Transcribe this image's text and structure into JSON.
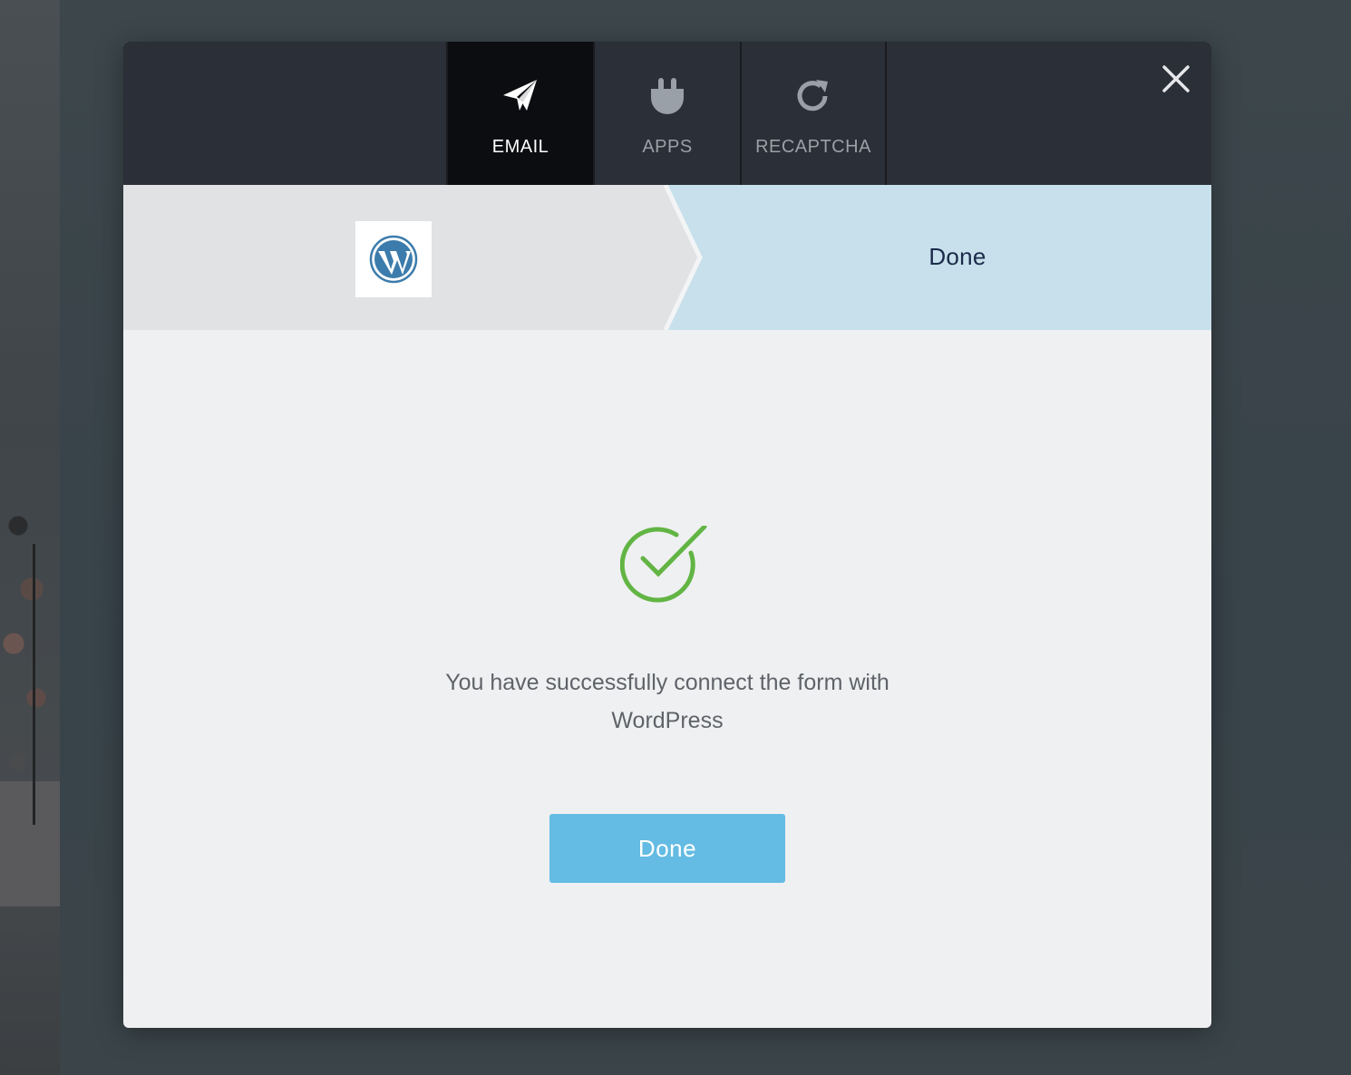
{
  "tabs": [
    {
      "label": "EMAIL",
      "icon": "paper-plane-icon",
      "active": true
    },
    {
      "label": "APPS",
      "icon": "plug-icon",
      "active": false
    },
    {
      "label": "RECAPTCHA",
      "icon": "refresh-icon",
      "active": false
    }
  ],
  "header": {
    "close_icon": "close-icon"
  },
  "steps": {
    "first": {
      "icon": "wordpress-logo"
    },
    "second": {
      "label": "Done"
    }
  },
  "content": {
    "success_icon": "check-circle-icon",
    "message": "You have successfully connect the form with WordPress",
    "done_button_label": "Done"
  },
  "colors": {
    "accent": "#64bbe3",
    "success": "#62b544",
    "header_bg": "#2b2f37",
    "active_tab_bg": "#0b0d11",
    "step_done_bg": "#c7e0eb",
    "wordpress_blue": "#3c7cac"
  }
}
